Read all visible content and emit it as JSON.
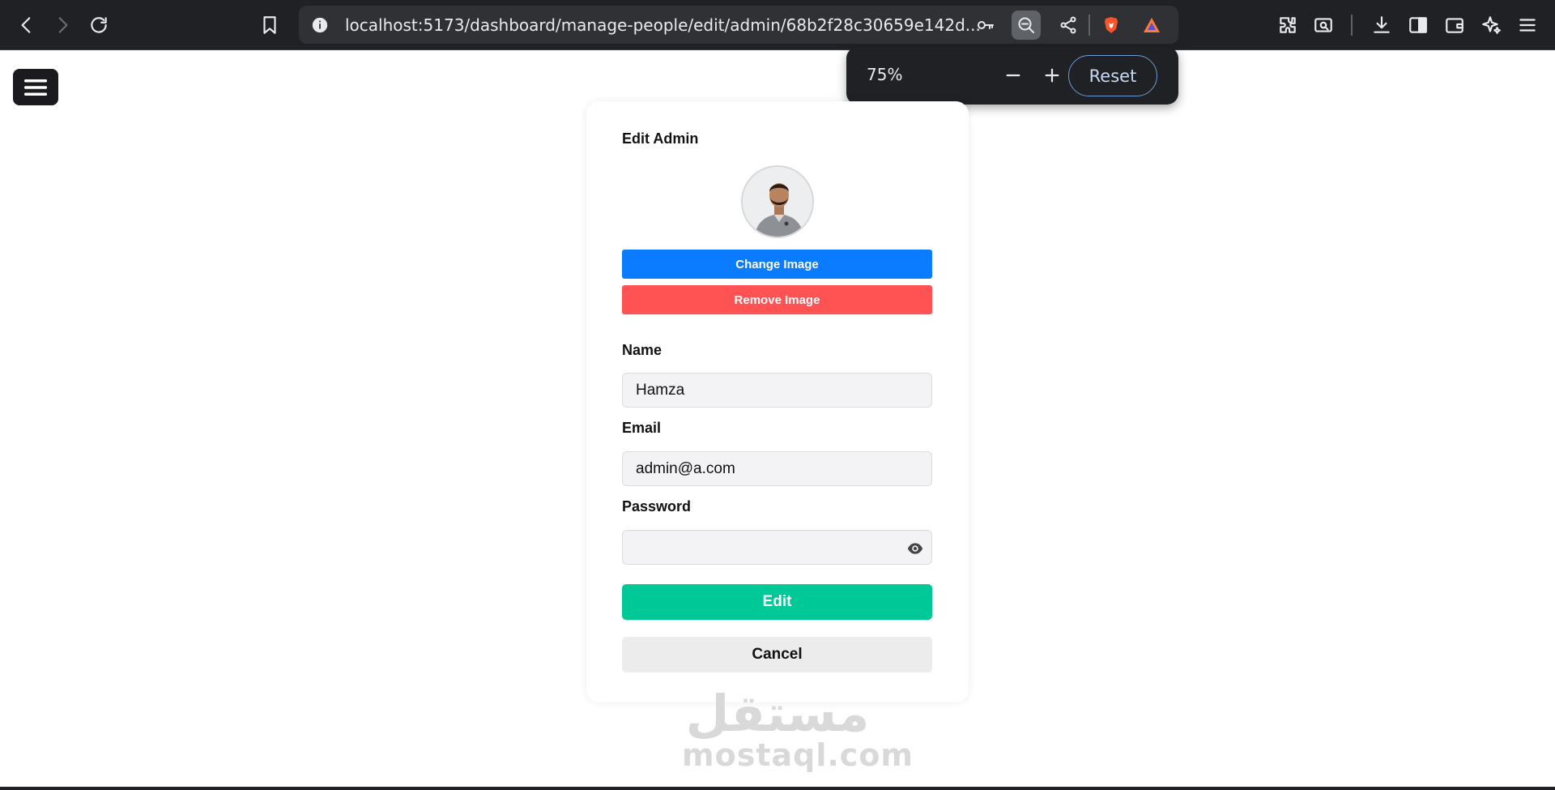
{
  "browser": {
    "url": "localhost:5173/dashboard/manage-people/edit/admin/68b2f28c30659e142d...",
    "zoom_level": "75%",
    "zoom_reset_label": "Reset"
  },
  "page": {
    "title": "Edit Admin",
    "change_image_label": "Change Image",
    "remove_image_label": "Remove Image",
    "name_label": "Name",
    "name_value": "Hamza",
    "email_label": "Email",
    "email_value": "admin@a.com",
    "password_label": "Password",
    "password_value": "",
    "edit_label": "Edit",
    "cancel_label": "Cancel"
  },
  "watermark": {
    "arabic": "مستقل",
    "latin": "mostaql.com"
  },
  "colors": {
    "change_image": "#0b7bff",
    "remove_image": "#ff5252",
    "edit": "#00c896",
    "cancel": "#ececec"
  }
}
